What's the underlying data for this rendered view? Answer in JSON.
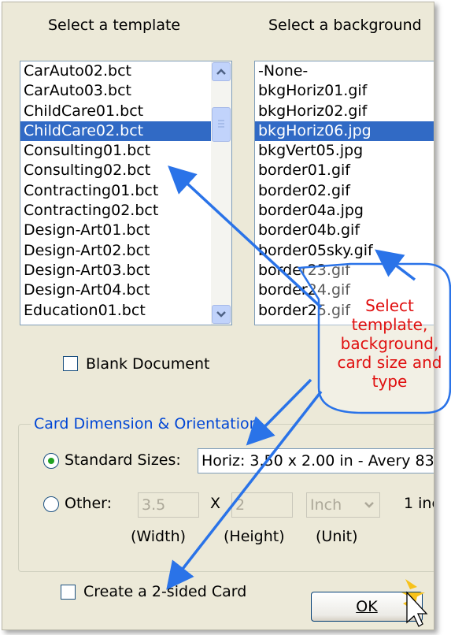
{
  "headers": {
    "template": "Select a template",
    "background": "Select a background"
  },
  "templates": {
    "items": [
      "CarAuto02.bct",
      "CarAuto03.bct",
      "ChildCare01.bct",
      "ChildCare02.bct",
      "Consulting01.bct",
      "Consulting02.bct",
      "Contracting01.bct",
      "Contracting02.bct",
      "Design-Art01.bct",
      "Design-Art02.bct",
      "Design-Art03.bct",
      "Design-Art04.bct",
      "Education01.bct"
    ],
    "selected": "ChildCare02.bct"
  },
  "backgrounds": {
    "items": [
      "-None-",
      "bkgHoriz01.gif",
      "bkgHoriz02.gif",
      "bkgHoriz06.jpg",
      "bkgVert05.jpg",
      "border01.gif",
      "border02.gif",
      "border04a.jpg",
      "border04b.gif",
      "border05sky.gif",
      "border23.gif",
      "border24.gif",
      "border25.gif"
    ],
    "selected": "bkgHoriz06.jpg"
  },
  "blank_document": {
    "label": "Blank Document",
    "checked": false
  },
  "card_dimension": {
    "title": "Card Dimension & Orientation",
    "standard_label": "Standard Sizes:",
    "standard_value": "Horiz: 3.50 x 2.00 in - Avery 83",
    "standard_selected": true,
    "other_label": "Other:",
    "width_value": "3.5",
    "x_label": "X",
    "height_value": "2",
    "unit_value": "Inch",
    "unit_note": "1 inc",
    "width_caption": "(Width)",
    "height_caption": "(Height)",
    "unit_caption": "(Unit)"
  },
  "two_sided": {
    "label": "Create a 2-sided Card",
    "checked": false
  },
  "ok_button": {
    "label": "OK"
  },
  "callout": {
    "lines": [
      "Select",
      "template,",
      "background,",
      "card size and",
      "type"
    ]
  },
  "colors": {
    "selection": "#316ac5",
    "annotation": "#2a73e8",
    "callout_text": "#e01010",
    "group_title": "#0046d5"
  }
}
